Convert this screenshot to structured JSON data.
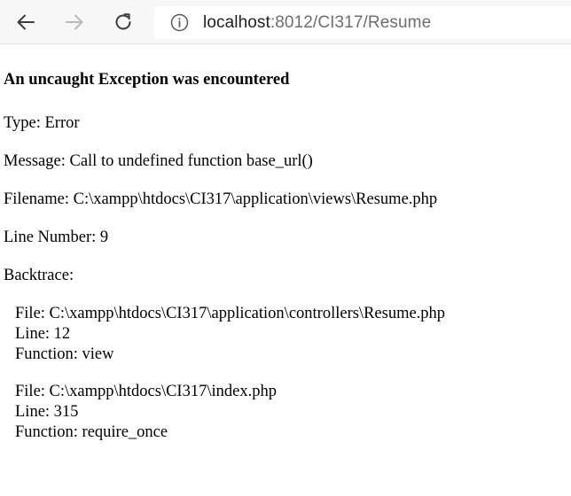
{
  "browser": {
    "url_host": "localhost",
    "url_rest": ":8012/CI317/Resume"
  },
  "error": {
    "heading": "An uncaught Exception was encountered",
    "type_line": "Type: Error",
    "message_line": "Message: Call to undefined function base_url()",
    "filename_line": "Filename: C:\\xampp\\htdocs\\CI317\\application\\views\\Resume.php",
    "line_number_line": "Line Number: 9",
    "backtrace_label": "Backtrace:",
    "backtrace": [
      {
        "file": "File: C:\\xampp\\htdocs\\CI317\\application\\controllers\\Resume.php",
        "line": "Line: 12",
        "function": "Function: view"
      },
      {
        "file": "File: C:\\xampp\\htdocs\\CI317\\index.php",
        "line": "Line: 315",
        "function": "Function: require_once"
      }
    ]
  },
  "icons": {
    "back": "back-arrow-icon",
    "forward": "forward-arrow-icon",
    "reload": "reload-icon",
    "info": "info-icon"
  }
}
